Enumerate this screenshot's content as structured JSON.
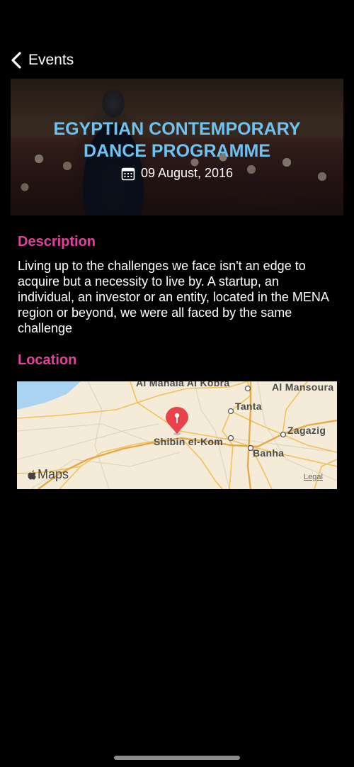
{
  "nav": {
    "back_label": "Events"
  },
  "event": {
    "title": "EGYPTIAN CONTEMPORARY DANCE PROGRAMME",
    "date": "09 August, 2016"
  },
  "description": {
    "heading": "Description",
    "text": "Living up to the challenges we face isn't an edge to acquire but a necessity to live by. A startup, an individual, an investor or an entity, located in the MENA region or beyond, we were all faced by the same challenge"
  },
  "location": {
    "heading": "Location",
    "map": {
      "places": [
        "Al Mahala Al Kobra",
        "Al Mansoura",
        "Tanta",
        "Zagazig",
        "Shibin el-Kom",
        "Banha"
      ],
      "provider": "Maps",
      "legal": "Legal"
    }
  },
  "colors": {
    "title": "#6ec2f2",
    "section_heading": "#e0439c",
    "pin": "#e8424a",
    "background": "#000000"
  },
  "icons": [
    "chevron-left-icon",
    "calendar-icon",
    "map-pin-icon",
    "apple-logo-icon"
  ]
}
